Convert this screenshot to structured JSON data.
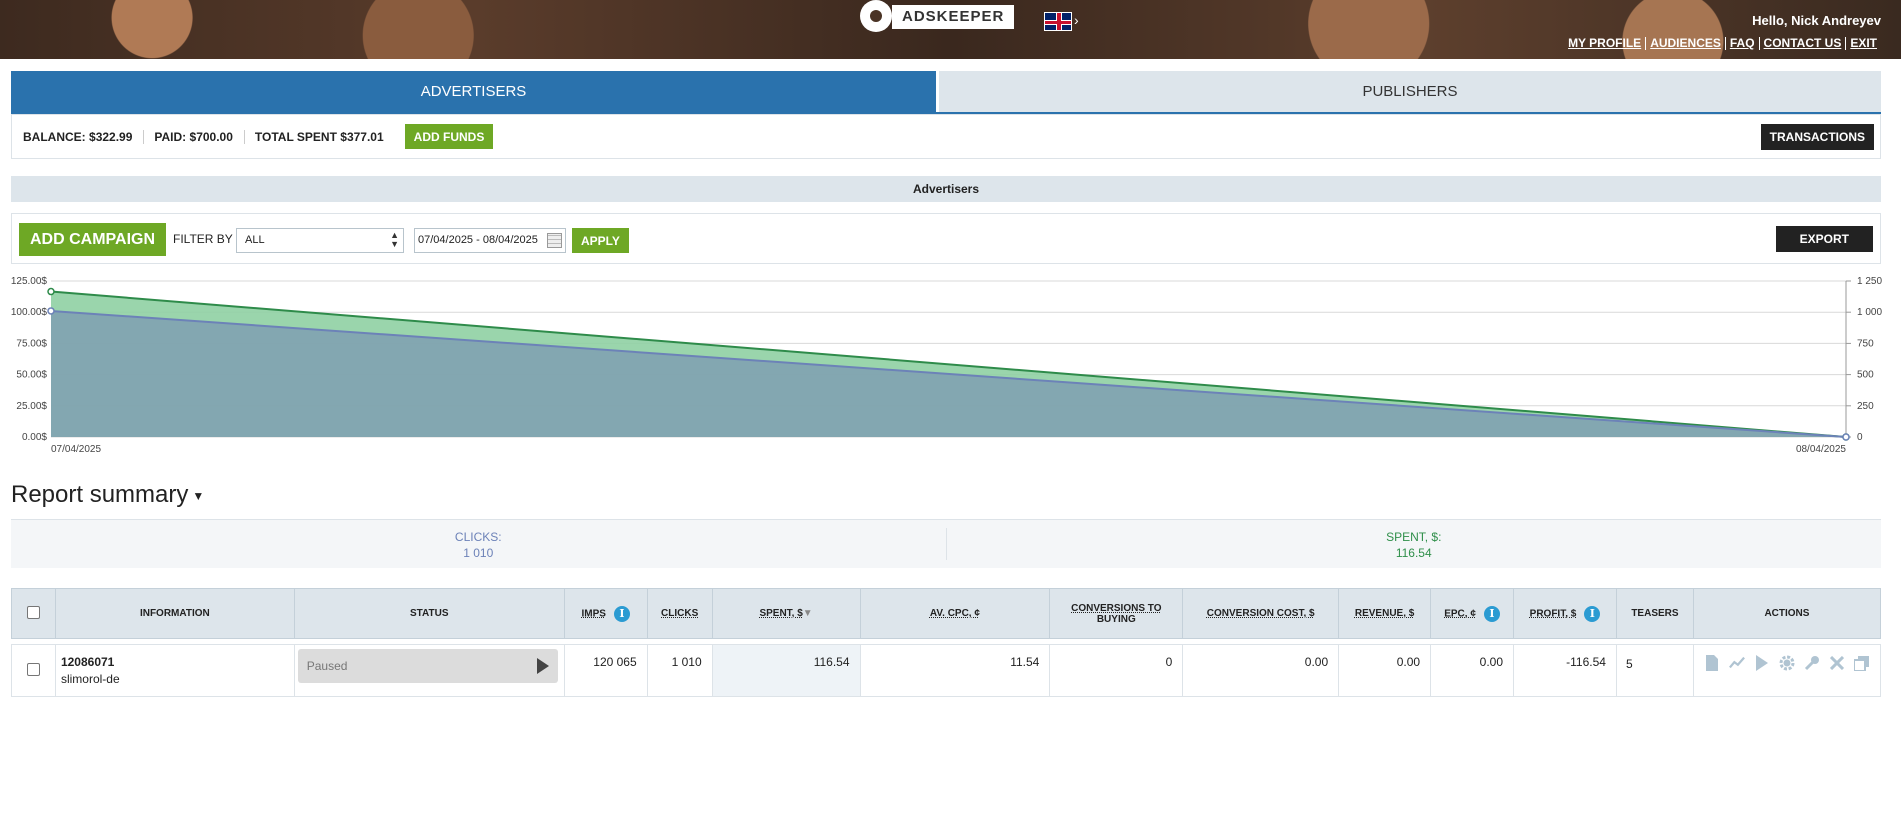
{
  "header": {
    "logo_text": "ADSKEEPER",
    "greeting": "Hello, Nick Andreyev",
    "links": [
      "MY PROFILE",
      "AUDIENCES",
      "FAQ",
      "CONTACT US",
      "EXIT"
    ]
  },
  "tabs": {
    "advertisers": "ADVERTISERS",
    "publishers": "PUBLISHERS"
  },
  "balance": {
    "balance_label": "BALANCE:",
    "balance_value": "$322.99",
    "paid_label": "PAID:",
    "paid_value": "$700.00",
    "spent_label": "TOTAL SPENT",
    "spent_value": "$377.01",
    "add_funds": "ADD FUNDS",
    "transactions": "TRANSACTIONS"
  },
  "section_title": "Advertisers",
  "filter": {
    "add_campaign": "ADD CAMPAIGN",
    "filter_by": "FILTER BY",
    "select_value": "ALL",
    "date_range": "07/04/2025 - 08/04/2025",
    "apply": "APPLY",
    "export": "EXPORT"
  },
  "chart_data": {
    "type": "area",
    "x": [
      "07/04/2025",
      "08/04/2025"
    ],
    "y_left_ticks": [
      "0.00$",
      "25.00$",
      "50.00$",
      "75.00$",
      "100.00$",
      "125.00$"
    ],
    "y_right_ticks": [
      "0",
      "250",
      "500",
      "750",
      "1 000",
      "1 250"
    ],
    "ylim_left": [
      0,
      125
    ],
    "ylim_right": [
      0,
      1250
    ],
    "series": [
      {
        "values": [
          116.54,
          0
        ],
        "axis": "left",
        "color": "#2e8b4a"
      },
      {
        "values": [
          1010,
          0
        ],
        "axis": "right",
        "color": "#6c82b8"
      }
    ],
    "grid": true
  },
  "report": {
    "title": "Report summary",
    "clicks_label": "CLICKS:",
    "clicks_value": "1 010",
    "spent_label": "SPENT, $:",
    "spent_value": "116.54"
  },
  "table": {
    "headers": {
      "information": "INFORMATION",
      "status": "STATUS",
      "imps": "IMPS",
      "clicks": "CLICKS",
      "spent": "SPENT, $",
      "av_cpc": "AV. CPC, ¢",
      "conversions_1": "CONVERSIONS TO",
      "conversions_2": "BUYING",
      "conversion_cost": "CONVERSION COST, $",
      "revenue": "REVENUE, $",
      "epc": "EPC, ¢",
      "profit": "PROFIT, $",
      "teasers": "TEASERS",
      "actions": "ACTIONS"
    },
    "rows": [
      {
        "id": "12086071",
        "name": "slimorol-de",
        "status": "Paused",
        "imps": "120 065",
        "clicks": "1 010",
        "spent": "116.54",
        "av_cpc": "11.54",
        "conversions": "0",
        "conversion_cost": "0.00",
        "revenue": "0.00",
        "epc": "0.00",
        "profit": "-116.54",
        "teasers": "5"
      }
    ]
  },
  "colors": {
    "brand_blue": "#2a72ad",
    "green": "#6ea825",
    "info_blue": "#2b9bd2"
  },
  "icons": [
    "document-icon",
    "stats-icon",
    "play-icon",
    "gear-icon",
    "wrench-icon",
    "delete-icon",
    "copy-icon"
  ]
}
